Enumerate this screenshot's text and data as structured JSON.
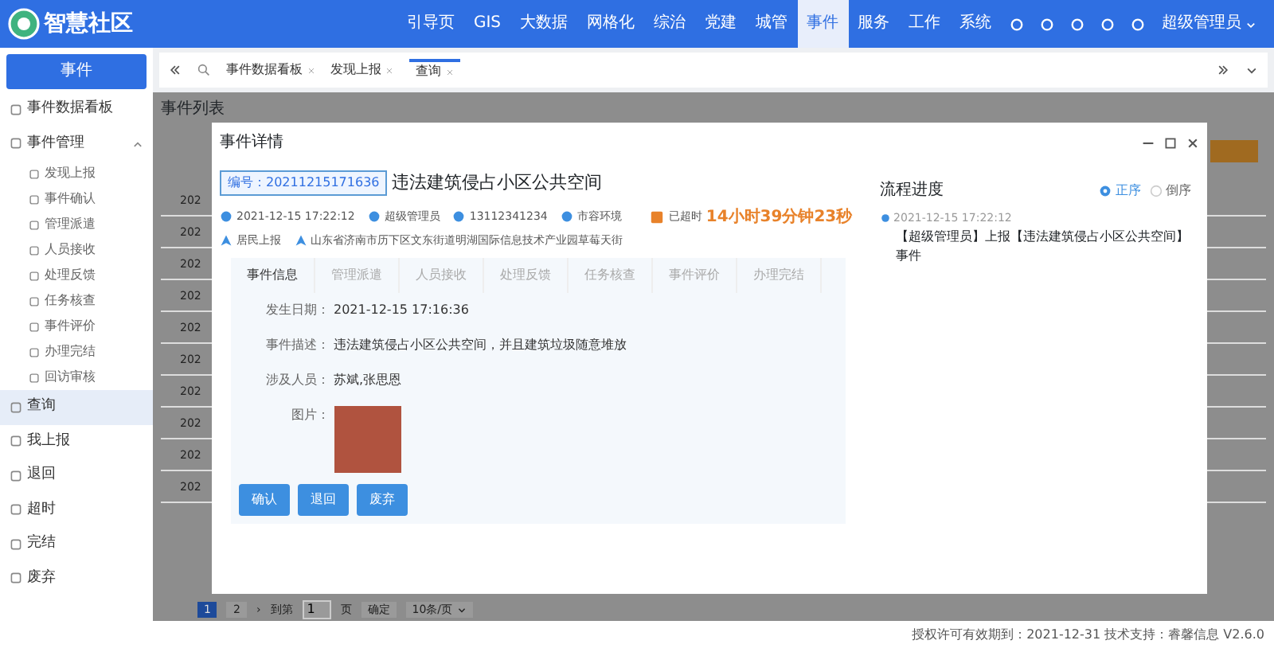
{
  "header": {
    "logo_text": "智慧社区",
    "nav": [
      {
        "label": "引导页",
        "selected": false
      },
      {
        "label": "GIS",
        "selected": false
      },
      {
        "label": "大数据",
        "selected": false
      },
      {
        "label": "网格化",
        "selected": false
      },
      {
        "label": "综治",
        "selected": false
      },
      {
        "label": "党建",
        "selected": false
      },
      {
        "label": "城管",
        "selected": false
      },
      {
        "label": "事件",
        "selected": true
      },
      {
        "label": "服务",
        "selected": false
      },
      {
        "label": "工作",
        "selected": false
      },
      {
        "label": "系统",
        "selected": false
      }
    ],
    "user": "超级管理员"
  },
  "sidebar": {
    "title": "事件",
    "items": [
      {
        "label": "事件数据看板",
        "selected": false
      },
      {
        "label": "事件管理",
        "selected": false,
        "expanded": true,
        "children": [
          {
            "label": "发现上报"
          },
          {
            "label": "事件确认"
          },
          {
            "label": "管理派遣"
          },
          {
            "label": "人员接收"
          },
          {
            "label": "处理反馈"
          },
          {
            "label": "任务核查"
          },
          {
            "label": "事件评价"
          },
          {
            "label": "办理完结"
          },
          {
            "label": "回访审核"
          }
        ]
      },
      {
        "label": "查询",
        "selected": true
      },
      {
        "label": "我上报",
        "selected": false
      },
      {
        "label": "退回",
        "selected": false
      },
      {
        "label": "超时",
        "selected": false
      },
      {
        "label": "完结",
        "selected": false
      },
      {
        "label": "废弃",
        "selected": false
      }
    ]
  },
  "page_tabs": [
    {
      "label": "事件数据看板",
      "selected": false
    },
    {
      "label": "发现上报",
      "selected": false
    },
    {
      "label": "查询",
      "selected": true
    }
  ],
  "content": {
    "title": "事件列表",
    "rows": [
      "202",
      "202",
      "202",
      "202",
      "202",
      "202",
      "202",
      "202",
      "202",
      "202"
    ],
    "pagination": {
      "pages": [
        {
          "label": "1",
          "selected": true
        },
        {
          "label": "2",
          "selected": false
        }
      ],
      "next": "›",
      "goto": "到第",
      "page_input": "1",
      "page_unit": "页",
      "confirm": "确定",
      "page_size": "10条/页"
    }
  },
  "modal": {
    "title": "事件详情",
    "code": "编号：20211215171636",
    "event_title": "违法建筑侵占小区公共空间",
    "time": "2021-12-15 17:22:12",
    "reporter": "超级管理员",
    "phone": "13112341234",
    "category": "市容环境",
    "source": "居民上报",
    "address": "山东省济南市历下区文东街道明湖国际信息技术产业园草莓天街",
    "overdue_label": "已超时",
    "overdue_time": "14小时39分钟23秒",
    "tabs": [
      {
        "label": "事件信息",
        "selected": true
      },
      {
        "label": "管理派遣",
        "selected": false
      },
      {
        "label": "人员接收",
        "selected": false
      },
      {
        "label": "处理反馈",
        "selected": false
      },
      {
        "label": "任务核查",
        "selected": false
      },
      {
        "label": "事件评价",
        "selected": false
      },
      {
        "label": "办理完结",
        "selected": false
      }
    ],
    "fields": [
      {
        "label": "发生日期：",
        "value": "2021-12-15 17:16:36",
        "kind": "text"
      },
      {
        "label": "事件描述：",
        "value": "违法建筑侵占小区公共空间，并且建筑垃圾随意堆放",
        "kind": "text"
      },
      {
        "label": "涉及人员：",
        "value": "苏斌,张思恩",
        "kind": "text"
      },
      {
        "label": "图片：",
        "kind": "photo"
      }
    ],
    "buttons": [
      "确认",
      "退回",
      "废弃"
    ],
    "progress": {
      "title": "流程进度",
      "order": [
        {
          "label": "正序",
          "selected": true
        },
        {
          "label": "倒序",
          "selected": false
        }
      ],
      "entries": [
        {
          "time": "2021-12-15 17:22:12",
          "text": "【超级管理员】上报【违法建筑侵占小区公共空间】事件"
        }
      ]
    }
  },
  "footer": "授权许可有效期到：2021-12-31  技术支持：睿馨信息  V2.6.0"
}
